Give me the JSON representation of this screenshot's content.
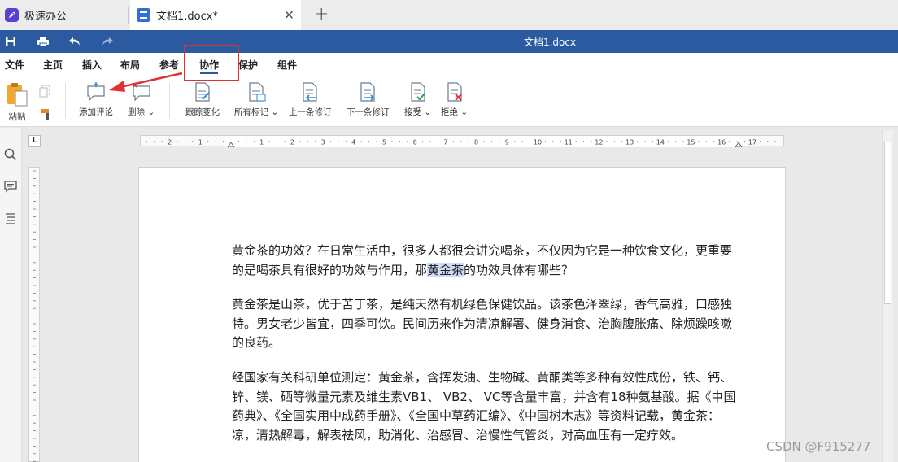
{
  "tabs": {
    "home_label": "极速办公",
    "doc_label": "文档1.docx*",
    "close_glyph": "✕",
    "add_glyph": "+"
  },
  "titlebar": {
    "title": "文档1.docx"
  },
  "menu": [
    "文件",
    "主页",
    "插入",
    "布局",
    "参考",
    "协作",
    "保护",
    "组件"
  ],
  "active_menu": "协作",
  "toolbar": {
    "paste": "粘贴",
    "add_comment": "添加评论",
    "delete": "删除",
    "track_changes": "跟踪变化",
    "all_markup": "所有标记",
    "prev_change": "上一条修订",
    "next_change": "下一条修订",
    "accept": "接受",
    "reject": "拒绝",
    "dropdown_glyph": "⌄"
  },
  "ruler": {
    "h_numbers": [
      "2",
      "1",
      "1",
      "2",
      "3",
      "4",
      "5",
      "6",
      "7",
      "8",
      "9",
      "10",
      "11",
      "12",
      "13",
      "14",
      "15",
      "16",
      "17"
    ],
    "corner": "L"
  },
  "document": {
    "p1_before": "黄金茶的功效？在日常生活中，很多人都很会讲究喝茶，不仅因为它是一种饮食文化，更重要的是喝茶具有很好的功效与作用，那",
    "p1_selected": "黄金茶",
    "p1_after": "的功效具体有哪些？",
    "p2": "黄金茶是山茶，优于苦丁茶，是纯天然有机绿色保健饮品。该茶色泽翠绿，香气高雅，口感独特。男女老少皆宜，四季可饮。民间历来作为清凉解署、健身消食、治胸腹胀痛、除烦躁咳嗽的良药。",
    "p3": "经国家有关科研单位测定：黄金茶，含挥发油、生物碱、黄酮类等多种有效性成份，铁、钙、锌、镁、硒等微量元素及维生素VB1、 VB2、 VC等含量丰富，并含有18种氨基酸。据《中国药典》、《全国实用中成药手册》、《全国中草药汇编》、《中国树木志》等资料记载，黄金茶：凉，清热解毒，解表祛风，助消化、治感冒、治慢性气管炎，对高血压有一定疗效。"
  },
  "watermark": "CSDN @F915277",
  "colors": {
    "accent": "#2c5aa0",
    "highlight": "#e03131",
    "selection": "#cfdcf5"
  }
}
